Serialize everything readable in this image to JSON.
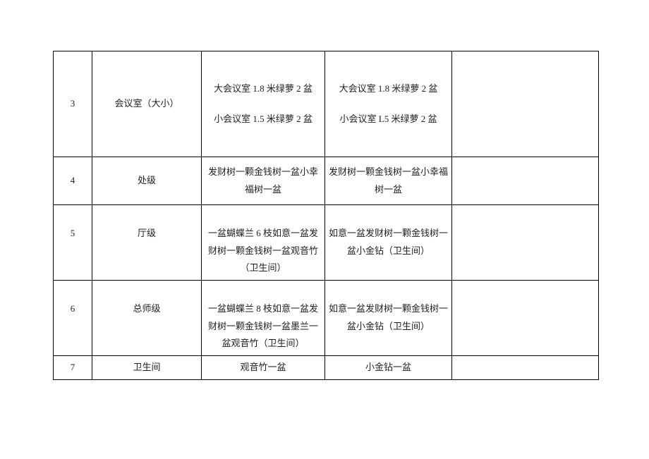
{
  "rows": [
    {
      "num": "3",
      "name": "会议室（大小）",
      "col3_line1": "大会议室 1.8 米绿萝 2 盆",
      "col3_line2": "小会议室 1.5 米绿萝 2 盆",
      "col4_line1": "大会议室 1.8 米绿萝 2 盆",
      "col4_line2": "小会议室 L5 米绿萝 2 盆",
      "col5": ""
    },
    {
      "num": "4",
      "name": "处级",
      "col3": "发财树一颗金钱树一盆小幸福树一盆",
      "col4": "发财树一颗金钱树一盆小幸福树一盆",
      "col5": ""
    },
    {
      "num": "5",
      "name": "厅级",
      "col3": "一盆蝴蝶兰 6 枝如意一盆发财树一颗金钱树一盆观音竹（卫生间）",
      "col4": "如意一盆发财树一颗金钱树一盆小金钻（卫生间）",
      "col5": ""
    },
    {
      "num": "6",
      "name": "总师级",
      "col3": "一盆蝴蝶兰 8 枝如意一盆发财树一颗金钱树一盆墨兰一盆观音竹（卫生间）",
      "col4": "如意一盆发财树一颗金钱树一盆小金钻（卫生间）",
      "col5": ""
    },
    {
      "num": "7",
      "name": "卫生间",
      "col3": "观音竹一盆",
      "col4": "小金钻一盆",
      "col5": ""
    }
  ]
}
